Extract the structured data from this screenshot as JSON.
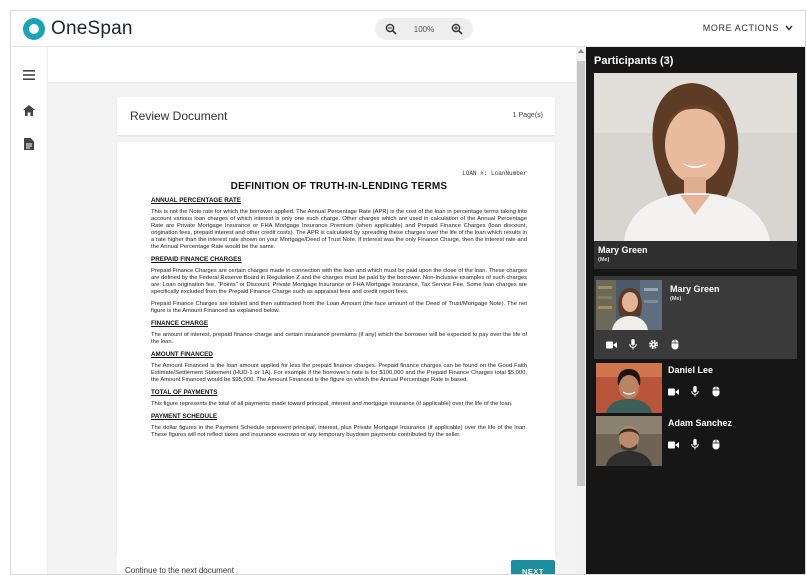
{
  "header": {
    "logo_text": "OneSpan",
    "zoom_level": "100%",
    "more_actions_label": "MORE ACTIONS"
  },
  "review": {
    "title": "Review Document",
    "page_count": "1 Page(s)"
  },
  "document": {
    "loan_number": "LOAN #: LoanNumber",
    "title": "DEFINITION OF TRUTH-IN-LENDING TERMS",
    "sections": [
      {
        "heading": "ANNUAL PERCENTAGE RATE",
        "paragraphs": [
          "This is not the Note rate for which the borrower applied. The Annual Percentage Rate (APR) is the cost of the loan in percentage terms taking into account various loan charges of which interest is only one such charge. Other charges which are used in calculation of the Annual Percentage Rate are Private Mortgage Insurance or FHA Mortgage Insurance Premium (when applicable) and Prepaid Finance Charges (loan discount, origination fees, prepaid interest and other credit costs). The APR is calculated by spreading these charges over the life of the loan which results in a rate higher than the interest rate shown on your Mortgage/Deed of Trust Note. If interest was the only Finance Charge, then the interest rate and the Annual Percentage Rate would be the same."
        ]
      },
      {
        "heading": "PREPAID FINANCE CHARGES",
        "paragraphs": [
          "Prepaid Finance Charges are certain charges made in connection with the loan and which must be paid upon the close of the loan. These charges are defined by the Federal Reserve Board in Regulation Z and the charges must be paid by the borrower. Non-Inclusive examples of such charges are: Loan origination fee, \"Points\" or Discount, Private Mortgage Insurance or FHA Mortgage Insurance, Tax Service Fee. Some loan charges are specifically excluded from the Prepaid Finance Charge such as appraisal fees and credit report fees.",
          "Prepaid Finance Charges are totaled and then subtracted from the Loan Amount (the face amount of the Deed of Trust/Mortgage Note). The net figure is the Amount Financed as explained below."
        ]
      },
      {
        "heading": "FINANCE CHARGE",
        "paragraphs": [
          "The amount of interest, prepaid finance charge and certain insurance premiums (if any) which the borrower will be expected to pay over the life of the loan."
        ]
      },
      {
        "heading": "AMOUNT FINANCED",
        "paragraphs": [
          "The Amount Financed is the loan amount applied for less the prepaid finance charges. Prepaid finance charges can be found on the Good Faith Estimate/Settlement Statement (HUD-1 or 1A). For example if the borrower's note is for $100,000 and the Prepaid Finance Charges total $5,000, the Amount Financed would be $95,000. The Amount Financed is the figure on which the Annual Percentage Rate is based."
        ]
      },
      {
        "heading": "TOTAL OF PAYMENTS",
        "paragraphs": [
          "This figure represents the total of all payments made toward principal, interest and mortgage insurance (if applicable) over the life of the loan."
        ]
      },
      {
        "heading": "PAYMENT SCHEDULE",
        "paragraphs": [
          "The dollar figures in the Payment Schedule represent principal, interest, plus Private Mortgage Insurance (if applicable) over the life of the loan. These figures will not reflect taxes and insurance escrows or any temporary buydown payments contributed by the seller."
        ]
      }
    ]
  },
  "footer": {
    "text": "Continue to the next document",
    "next_label": "NEXT"
  },
  "participants": {
    "title": "Participants (3)",
    "main_name": "Mary Green",
    "main_me": "(Me)",
    "list": [
      {
        "name": "Mary Green",
        "me": "(Me)"
      },
      {
        "name": "Daniel Lee"
      },
      {
        "name": "Adam Sanchez"
      }
    ]
  },
  "colors": {
    "brand": "#16a5b7",
    "next_button": "#1b8fa0",
    "panel_bg": "#161616"
  }
}
